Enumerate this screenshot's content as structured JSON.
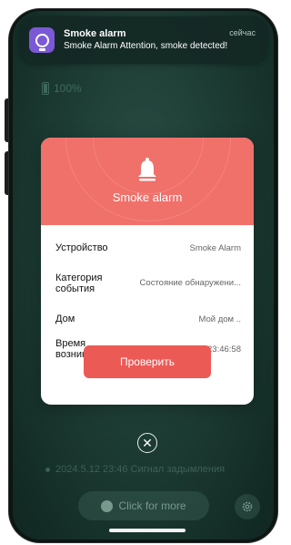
{
  "notification": {
    "title": "Smoke alarm",
    "time": "сейчас",
    "body": "Smoke Alarm  Attention, smoke detected!",
    "icon": "smart-bulb-icon"
  },
  "status": {
    "battery": "100%"
  },
  "alert": {
    "title": "Smoke alarm",
    "icon": "bell-icon",
    "rows": [
      {
        "label": "Устройство",
        "value": "Smoke Alarm"
      },
      {
        "label": "Категория события",
        "value": "Состояние обнаружени..."
      },
      {
        "label": "Дом",
        "value": "Мой дом .."
      },
      {
        "label": "Время возникновен",
        "value": "2024-05-12 23:46:58"
      }
    ],
    "check_button": "Проверить"
  },
  "history": {
    "text": "2024.5.12 23:46 Сигнал задымления"
  },
  "more_button": "Click for more",
  "colors": {
    "accent": "#ec5a55",
    "header": "#f0706a",
    "background": "#2b574b",
    "notification_icon": "#7b59d6"
  }
}
